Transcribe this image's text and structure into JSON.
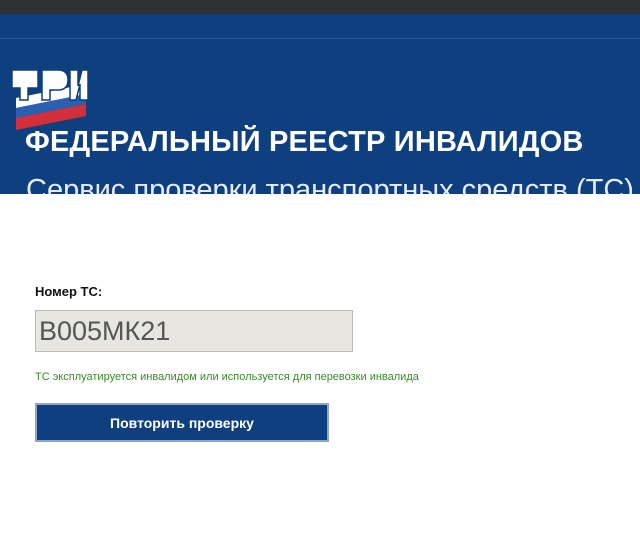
{
  "header": {
    "title": "ФЕДЕРАЛЬНЫЙ РЕЕСТР ИНВАЛИДОВ",
    "subtitle": "Сервис проверки транспортных средств (ТС)",
    "logo_icon": "fri-logo-icon"
  },
  "form": {
    "label": "Номер ТС:",
    "plate_value": "В005МК21"
  },
  "status": {
    "message": "ТС эксплуатируется инвалидом или используется для перевозки инвалида",
    "color": "#3a8a2a"
  },
  "actions": {
    "retry_label": "Повторить проверку"
  },
  "colors": {
    "brand": "#0e3f7e",
    "topbar": "#2f3033"
  }
}
